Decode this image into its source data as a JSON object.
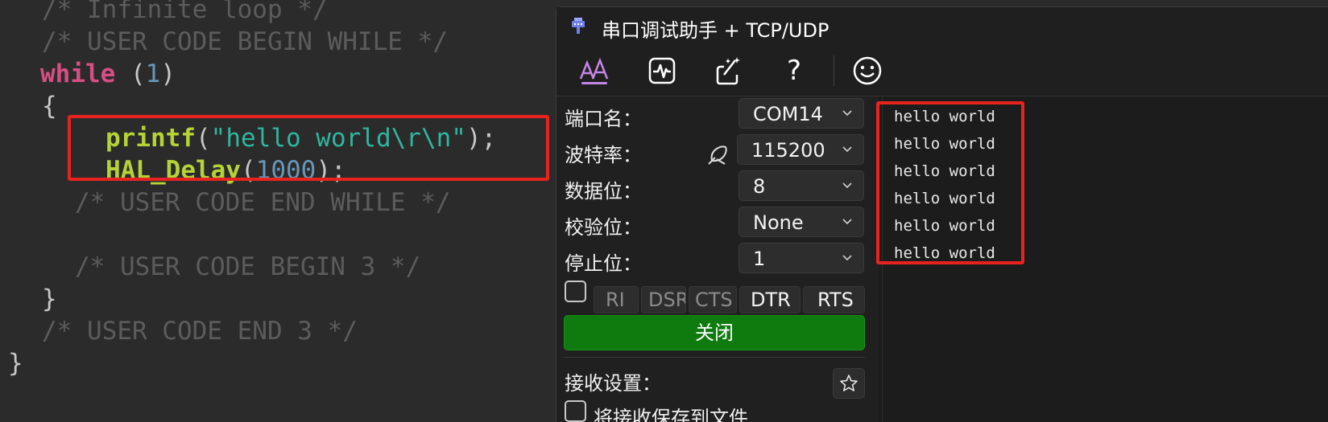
{
  "editor": {
    "lines": {
      "l1": "/* Infinite loop */",
      "l2": "/* USER CODE BEGIN WHILE */",
      "l3_kw": "while",
      "l3_open": " (",
      "l3_num": "1",
      "l3_close": ")",
      "l4": "{",
      "l5_fn": "printf",
      "l5_open": "(",
      "l5_str": "\"hello world\\r\\n\"",
      "l5_close": ");",
      "l6_fn": "HAL_Delay",
      "l6_open": "(",
      "l6_num": "1000",
      "l6_close": ");",
      "l7": "/* USER CODE END WHILE */",
      "l8": "/* USER CODE BEGIN 3 */",
      "l9": "}",
      "l10": "/* USER CODE END 3 */",
      "l11": "}"
    }
  },
  "app": {
    "title": "串口调试助手 + TCP/UDP",
    "toolbar": {
      "help_label": "?"
    },
    "port": {
      "label": "端口名：",
      "value": "COM14"
    },
    "baud": {
      "label": "波特率：",
      "value": "115200"
    },
    "databits": {
      "label": "数据位：",
      "value": "8"
    },
    "parity": {
      "label": "校验位：",
      "value": "None"
    },
    "stopbits": {
      "label": "停止位：",
      "value": "1"
    },
    "signals": {
      "ri": "RI",
      "dsr": "DSR",
      "cts": "CTS",
      "dtr": "DTR",
      "rts": "RTS"
    },
    "close_button": "关闭",
    "receive_settings_label": "接收设置：",
    "save_to_file_label": "将接收保存到文件",
    "received": [
      "hello world",
      "hello world",
      "hello world",
      "hello world",
      "hello world",
      "hello world"
    ]
  },
  "colors": {
    "highlight_box": "#e8231f",
    "close_button_bg": "#0f7b0f",
    "toolbar_accent": "#c586e8"
  }
}
